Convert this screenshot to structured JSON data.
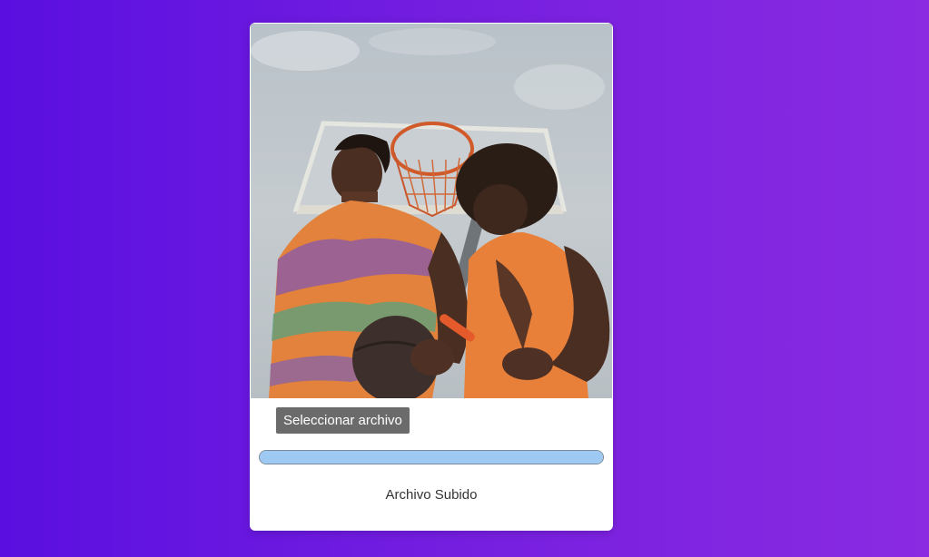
{
  "card": {
    "image_alt": "Two men with a basketball under a hoop",
    "select_button_label": "Seleccionar archivo",
    "upload_progress_fraction": 1.0,
    "status_text": "Archivo Subido"
  },
  "colors": {
    "background_start": "#5a0fe0",
    "background_end": "#8a2be2",
    "progress_fill": "#9ec9f3",
    "button_bg": "#6b6b6b"
  }
}
